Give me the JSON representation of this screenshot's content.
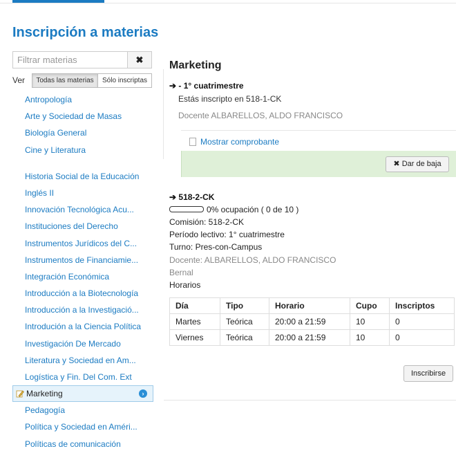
{
  "page": {
    "title": "Inscripción a materias"
  },
  "filter": {
    "placeholder": "Filtrar materias",
    "clear_label": "✖"
  },
  "view": {
    "label": "Ver",
    "options": [
      "Todas las materias",
      "Sólo inscriptas"
    ],
    "selected": "Todas las materias"
  },
  "subjects": {
    "items_top": [
      "Antropología",
      "Arte y Sociedad de Masas",
      "Biología General",
      "Cine y Literatura"
    ],
    "items_bottom": [
      "Historia Social de la Educación",
      "Inglés II",
      "Innovación Tecnológica Acu...",
      "Instituciones del Derecho",
      "Instrumentos Jurídicos del C...",
      "Instrumentos de Financiamie...",
      "Integración Económica",
      "Introducción a la Biotecnología",
      "Introducción a la Investigació...",
      "Introdución a la Ciencia Política",
      "Investigación De Mercado",
      "Literatura y Sociedad en Am...",
      "Logística y Fin. Del Com. Ext"
    ],
    "active": "Marketing",
    "items_after": [
      "Pedagogía",
      "Política y Sociedad en Améri...",
      "Políticas de comunicación"
    ]
  },
  "detail": {
    "subject": "Marketing",
    "enrolled": {
      "heading": "- 1° cuatrimestre",
      "text": "Estás inscripto en 518-1-CK",
      "teacher": "Docente ALBARELLOS, ALDO FRANCISCO",
      "receipt_link": "Mostrar comprobante",
      "drop_button": "Dar de baja"
    },
    "commission": {
      "heading": "518-2-CK",
      "occupancy_text": "0% ocupación ( 0 de 10 )",
      "occupancy_fraction": 0,
      "commission": "Comisión: 518-2-CK",
      "period": "Período lectivo: 1° cuatrimestre",
      "shift": "Turno: Pres-con-Campus",
      "teacher": "Docente: ALBARELLOS, ALDO FRANCISCO",
      "location": "Bernal",
      "schedule_label": "Horarios",
      "table": {
        "headers": [
          "Día",
          "Tipo",
          "Horario",
          "Cupo",
          "Inscriptos"
        ],
        "rows": [
          [
            "Martes",
            "Teórica",
            "20:00 a 21:59",
            "10",
            "0"
          ],
          [
            "Viernes",
            "Teórica",
            "20:00 a 21:59",
            "10",
            "0"
          ]
        ]
      },
      "enroll_button": "Inscribirse"
    }
  },
  "colors": {
    "accent": "#1b7bc2",
    "success_panel": "#dff0d8",
    "active_item": "#e6f3fb"
  }
}
